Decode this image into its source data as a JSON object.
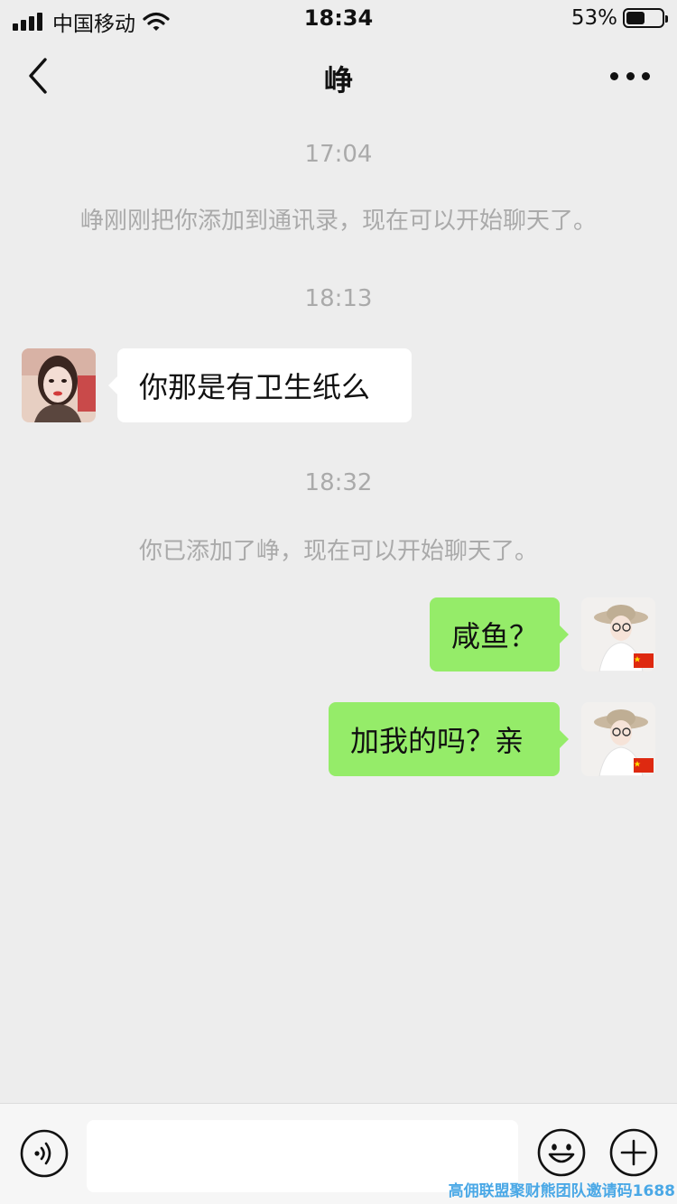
{
  "status_bar": {
    "carrier": "中国移动",
    "time": "18:34",
    "battery_percent": "53%",
    "battery_level": 0.53,
    "icons": [
      "signal-icon",
      "wifi-icon",
      "battery-icon"
    ]
  },
  "nav": {
    "title": "峥",
    "back_icon": "chevron-left-icon",
    "more_icon": "more-dots-icon"
  },
  "chat": {
    "timestamp_1": "17:04",
    "system_1": "峥刚刚把你添加到通讯录，现在可以开始聊天了。",
    "timestamp_2": "18:13",
    "msg_1": "你那是有卫生纸么",
    "timestamp_3": "18:32",
    "system_2": "你已添加了峥，现在可以开始聊天了。",
    "msg_2": "咸鱼？",
    "msg_3": "加我的吗？亲"
  },
  "input_bar": {
    "value": "",
    "icons": [
      "voice-icon",
      "emoji-icon",
      "plus-icon"
    ]
  },
  "watermark": "高佣联盟聚财熊团队邀请码1688",
  "colors": {
    "background": "#ededed",
    "incoming_bubble": "#ffffff",
    "outgoing_bubble": "#95ec69",
    "system_text": "#aaaaaa"
  }
}
